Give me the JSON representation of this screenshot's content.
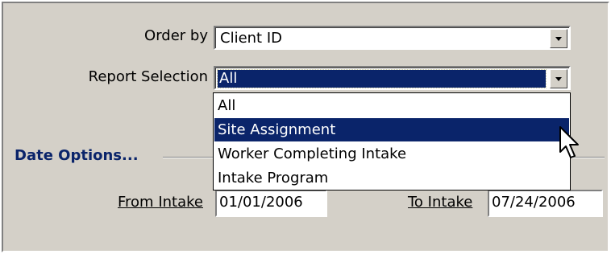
{
  "order_by": {
    "label": "Order by",
    "value": "Client ID"
  },
  "report_selection": {
    "label": "Report Selection",
    "value": "All",
    "options": [
      "All",
      "Site Assignment",
      "Worker Completing Intake",
      "Intake Program"
    ],
    "highlighted_option": "Site Assignment"
  },
  "date_options": {
    "title": "Date Options...",
    "from_label": "From Intake",
    "from_value": "01/01/2006",
    "to_label": "To Intake",
    "to_value": "07/24/2006"
  },
  "colors": {
    "panel_bg": "#d4d0c8",
    "selection_bg": "#0a246a",
    "section_title": "#0a246a"
  },
  "icons": {
    "dropdown_arrow": "chevron-down-icon",
    "cursor": "mouse-pointer-icon"
  }
}
